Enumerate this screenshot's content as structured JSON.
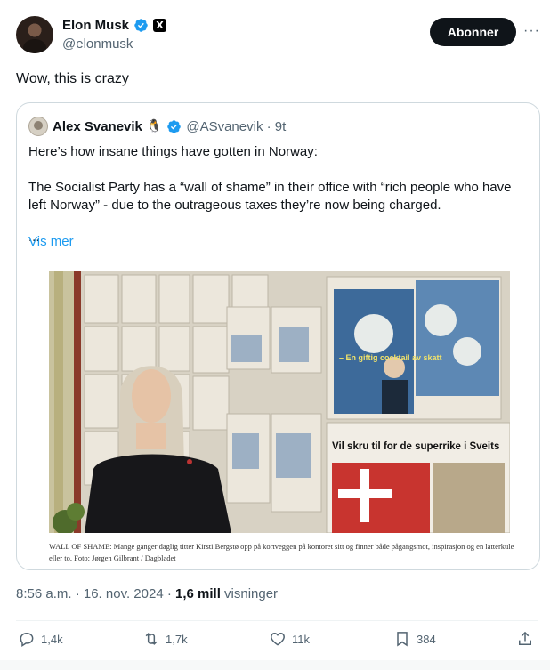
{
  "author": {
    "name": "Elon Musk",
    "handle": "@elonmusk",
    "follow_label": "Abonner",
    "more": "···",
    "x_badge": "X"
  },
  "tweet": {
    "text": "Wow, this is crazy"
  },
  "quote": {
    "name": "Alex Svanevik",
    "emoji": "🐧",
    "handle_time": "@ASvanevik · 9t",
    "line1": "Here’s how insane things have gotten in Norway:",
    "line2": "The Socialist Party has a “wall of shame” in their office with “rich people who have left Norway” - due to the outrageous taxes they’re now being charged.",
    "ellipsis": "...",
    "show_more": "Vis mer",
    "image": {
      "headline_small": "– En giftig cocktail av skatt",
      "headline_large": "Vil skru til for de superrike i Sveits",
      "caption": "WALL OF SHAME: Mange ganger daglig titter Kirsti Bergstø opp på kortveggen på kontoret sitt og finner både pågangsmot, inspirasjon og en latterkule eller to. Foto: Jørgen Gilbrant / Dagbladet"
    }
  },
  "meta": {
    "time_date": "8:56 a.m. · 16. nov. 2024 · ",
    "views_count": "1,6 mill",
    "views_label": " visninger"
  },
  "actions": {
    "replies": "1,4k",
    "reposts": "1,7k",
    "likes": "11k",
    "bookmarks": "384"
  },
  "colors": {
    "accent": "#1d9bf0",
    "text": "#0f1419",
    "muted": "#536471"
  }
}
